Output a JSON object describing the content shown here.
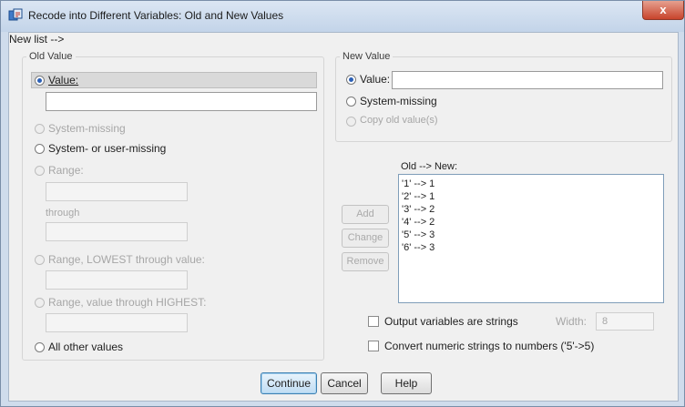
{
  "window": {
    "title": "Recode into Different Variables: Old and New Values",
    "close_label": "x"
  },
  "old_value": {
    "legend": "Old Value",
    "value_label": "Value:",
    "value_input": "",
    "system_missing": "System-missing",
    "system_or_user_missing": "System- or user-missing",
    "range": "Range:",
    "through": "through",
    "range_lowest": "Range, LOWEST through value:",
    "range_highest": "Range, value through HIGHEST:",
    "all_other": "All other values",
    "selected": "Value"
  },
  "new_value": {
    "legend": "New Value",
    "value_label": "Value:",
    "value_input": "",
    "system_missing": "System-missing",
    "copy_old": "Copy old value(s)",
    "selected": "Value"
  },
  "mapping": {
    "label": "Old --> New:",
    "items": [
      "'1' --> 1",
      "'2' --> 1",
      "'3' --> 2",
      "'4' --> 2",
      "'5' --> 3",
      "'6' --> 3"
    ]
  },
  "action_buttons": {
    "add": "Add",
    "change": "Change",
    "remove": "Remove"
  },
  "options": {
    "output_strings": "Output variables are strings",
    "output_strings_checked": false,
    "width_label": "Width:",
    "width_value": "8",
    "convert_numeric": "Convert numeric strings to numbers ('5'->5)",
    "convert_numeric_checked": false
  },
  "footer": {
    "continue": "Continue",
    "cancel": "Cancel",
    "help": "Help"
  },
  "colors": {
    "titlebar": "#c3d4e9",
    "close": "#c8442c",
    "accent": "#2c60b6",
    "dialog_bg": "#f0f0f0"
  }
}
